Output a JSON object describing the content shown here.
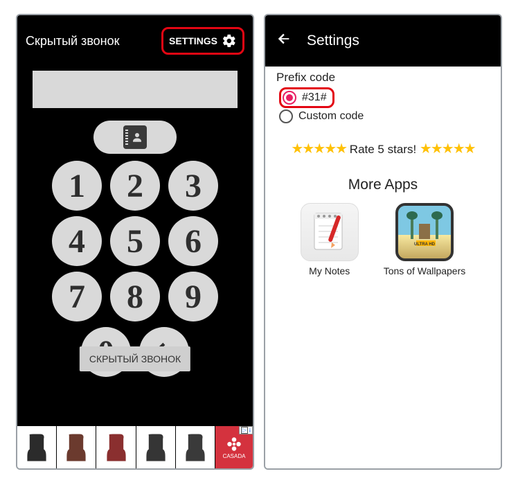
{
  "left": {
    "title": "Скрытый звонок",
    "settings_label": "SETTINGS",
    "keys": [
      "1",
      "2",
      "3",
      "4",
      "5",
      "6",
      "7",
      "8",
      "9",
      "0"
    ],
    "toast": "СКРЫТЫЙ ЗВОНОК",
    "ad_logo": "CASADA",
    "ad_badge": "i"
  },
  "right": {
    "title": "Settings",
    "prefix_label": "Prefix code",
    "option_31": "#31#",
    "option_custom": "Custom code",
    "stars": "★★★★★",
    "rate_text": " Rate 5 stars! ",
    "more_apps": "More Apps",
    "app1_label": "My Notes",
    "app2_label": "Tons of Wallpapers"
  }
}
